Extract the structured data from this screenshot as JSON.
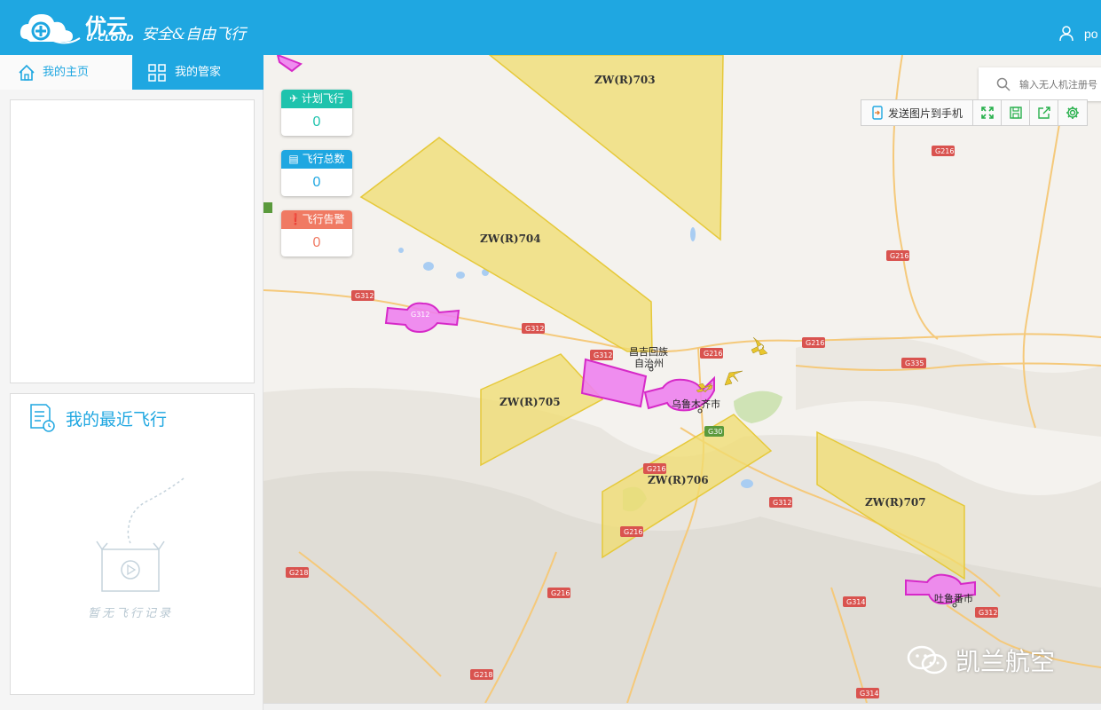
{
  "header": {
    "logo_cn": "优云",
    "logo_en": "U-CLOUD",
    "slogan": "安全&自由飞行",
    "user_name": "po"
  },
  "sidebar": {
    "tabs": [
      {
        "label": "我的主页",
        "icon": "home-icon"
      },
      {
        "label": "我的管家",
        "icon": "grid-icon"
      }
    ],
    "recent": {
      "title": "我的最近飞行",
      "empty_text": "暂无飞行记录"
    }
  },
  "stats": [
    {
      "label": "计划飞行",
      "value": "0",
      "icon": "plane-icon",
      "color": "#1ec3ad"
    },
    {
      "label": "飞行总数",
      "value": "0",
      "icon": "calendar-icon",
      "color": "#1fa7e1"
    },
    {
      "label": "飞行告警",
      "value": "0",
      "icon": "alert-icon",
      "color": "#f07a63"
    }
  ],
  "search": {
    "placeholder": "输入无人机注册号"
  },
  "toolbar": {
    "send_label": "发送图片到手机",
    "buttons": [
      "fullscreen-icon",
      "save-icon",
      "share-icon",
      "settings-icon"
    ]
  },
  "map": {
    "zones": [
      "ZW(R)703",
      "ZW(R)704",
      "ZW(R)705",
      "ZW(R)706",
      "ZW(R)707"
    ],
    "roads": [
      "G216",
      "G216",
      "G216",
      "G216",
      "G216",
      "G312",
      "G312",
      "G312",
      "G312",
      "G312",
      "G312",
      "G335",
      "G218",
      "G218",
      "G216",
      "G30",
      "G314",
      "G314",
      "G216"
    ],
    "cities": [
      "昌吉回族",
      "自治州",
      "乌鲁木齐市",
      "吐鲁番市"
    ],
    "colors": {
      "restricted": "#f0dc6e",
      "airport": "#ee82ee",
      "water": "#a9cdf2"
    }
  },
  "watermark": "凯兰航空"
}
